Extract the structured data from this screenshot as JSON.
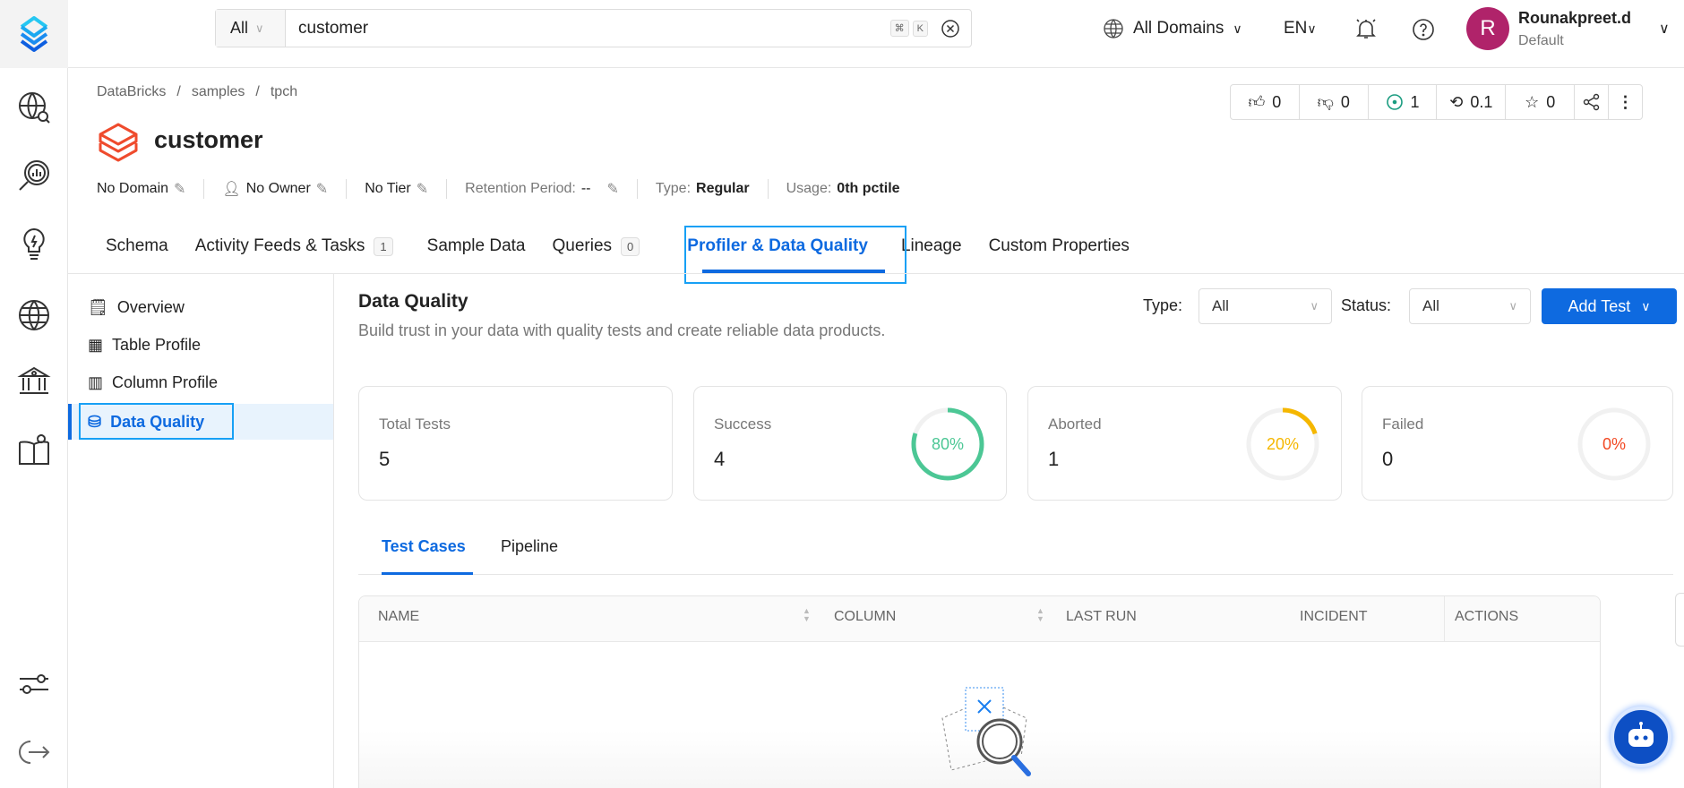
{
  "search": {
    "scope": "All",
    "query": "customer",
    "shortcut_cmd": "⌘",
    "shortcut_key": "K"
  },
  "header": {
    "domains": "All Domains",
    "language": "EN",
    "user_name": "Rounakpreet.d",
    "user_role": "Default",
    "avatar_initial": "R"
  },
  "breadcrumb": [
    "DataBricks",
    "samples",
    "tpch"
  ],
  "entity": {
    "title": "customer"
  },
  "actions": {
    "likes": "0",
    "dislikes": "0",
    "followers": "1",
    "version": "0.1",
    "stars": "0"
  },
  "meta": {
    "domain": "No Domain",
    "owner": "No Owner",
    "tier": "No Tier",
    "retention_label": "Retention Period:",
    "retention_value": "--",
    "type_label": "Type:",
    "type_value": "Regular",
    "usage_label": "Usage:",
    "usage_value": "0th pctile"
  },
  "tabs": [
    {
      "label": "Schema"
    },
    {
      "label": "Activity Feeds & Tasks",
      "count": "1"
    },
    {
      "label": "Sample Data"
    },
    {
      "label": "Queries",
      "count": "0"
    },
    {
      "label": "Profiler & Data Quality"
    },
    {
      "label": "Lineage"
    },
    {
      "label": "Custom Properties"
    }
  ],
  "subnav": [
    "Overview",
    "Table Profile",
    "Column Profile",
    "Data Quality"
  ],
  "dq": {
    "title": "Data Quality",
    "description": "Build trust in your data with quality tests and create reliable data products.",
    "type_label": "Type",
    "type_value": "All",
    "status_label": "Status",
    "status_value": "All",
    "add_test": "Add Test"
  },
  "cards": [
    {
      "label": "Total Tests",
      "value": "5"
    },
    {
      "label": "Success",
      "value": "4",
      "percent": "80%",
      "fraction": 0.8,
      "color": "#4cc795"
    },
    {
      "label": "Aborted",
      "value": "1",
      "percent": "20%",
      "fraction": 0.2,
      "color": "#f5b700"
    },
    {
      "label": "Failed",
      "value": "0",
      "percent": "0%",
      "fraction": 0,
      "color": "#f24822"
    }
  ],
  "subtabs": [
    "Test Cases",
    "Pipeline"
  ],
  "table": {
    "columns": [
      "NAME",
      "COLUMN",
      "LAST RUN",
      "INCIDENT",
      "ACTIONS"
    ]
  }
}
